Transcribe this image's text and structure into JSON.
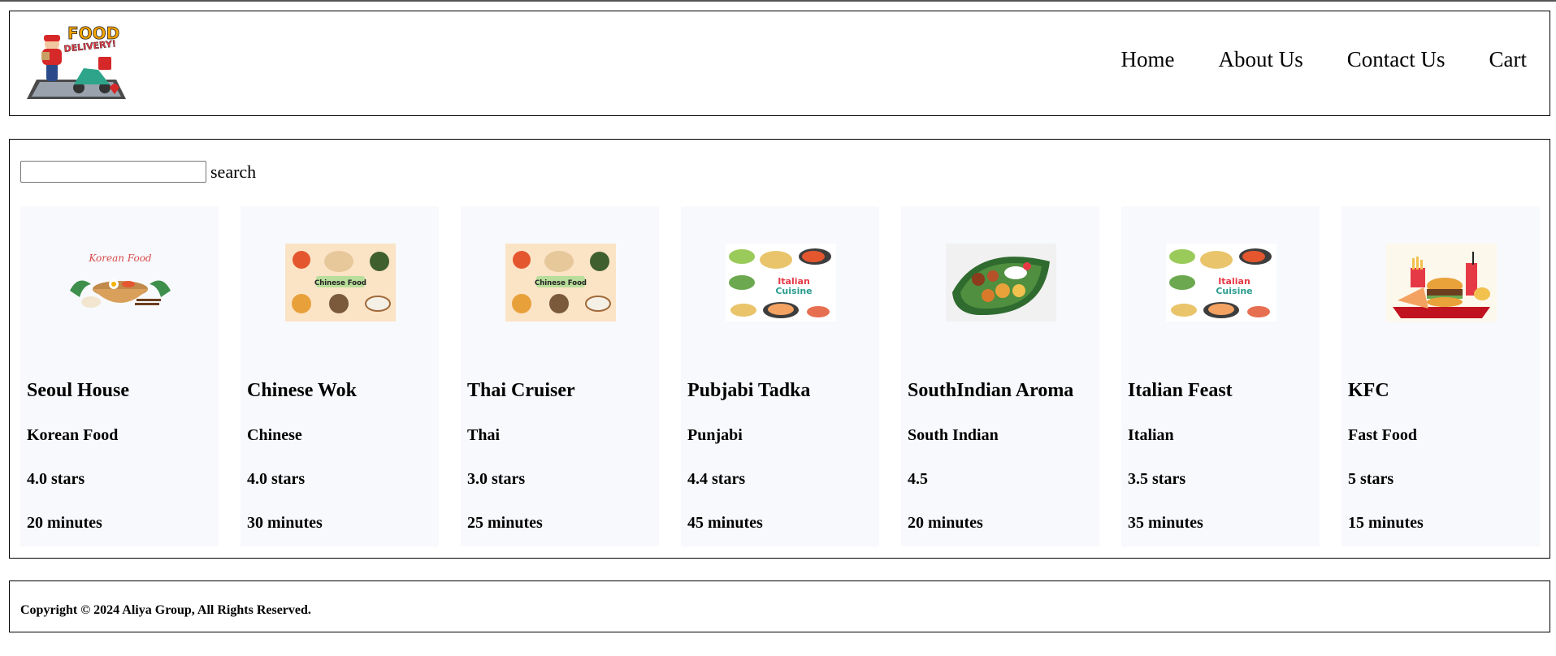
{
  "logo": {
    "text_line1": "FOOD",
    "text_line2": "DELIVERY!",
    "icon": "food-delivery-scooter-logo"
  },
  "nav": {
    "items": [
      "Home",
      "About Us",
      "Contact Us",
      "Cart"
    ]
  },
  "search": {
    "value": "",
    "placeholder": "",
    "label": "search"
  },
  "restaurants": [
    {
      "name": "Seoul House",
      "cuisine": "Korean Food",
      "rating": "4.0 stars",
      "time": "20 minutes",
      "image": "korean-food-icon",
      "image_caption": "Korean Food"
    },
    {
      "name": "Chinese Wok",
      "cuisine": "Chinese",
      "rating": "4.0 stars",
      "time": "30 minutes",
      "image": "chinese-food-icon",
      "image_caption": "Chinese Food"
    },
    {
      "name": "Thai Cruiser",
      "cuisine": "Thai",
      "rating": "3.0 stars",
      "time": "25 minutes",
      "image": "chinese-food-icon",
      "image_caption": "Chinese Food"
    },
    {
      "name": "Pubjabi Tadka",
      "cuisine": "Punjabi",
      "rating": "4.4 stars",
      "time": "45 minutes",
      "image": "italian-cuisine-icon",
      "image_caption": "Italian Cuisine"
    },
    {
      "name": "SouthIndian Aroma",
      "cuisine": "South Indian",
      "rating": "4.5",
      "time": "20 minutes",
      "image": "south-indian-platter-icon",
      "image_caption": ""
    },
    {
      "name": "Italian Feast",
      "cuisine": "Italian",
      "rating": "3.5 stars",
      "time": "35 minutes",
      "image": "italian-cuisine-icon",
      "image_caption": "Italian Cuisine"
    },
    {
      "name": "KFC",
      "cuisine": "Fast Food",
      "rating": "5 stars",
      "time": "15 minutes",
      "image": "fast-food-icon",
      "image_caption": ""
    }
  ],
  "footer": {
    "copyright": "Copyright © 2024 Aliya Group, All Rights Reserved."
  },
  "colors": {
    "card_bg": "#f8f9fc",
    "border": "#000000",
    "page_bg": "#ffffff"
  }
}
